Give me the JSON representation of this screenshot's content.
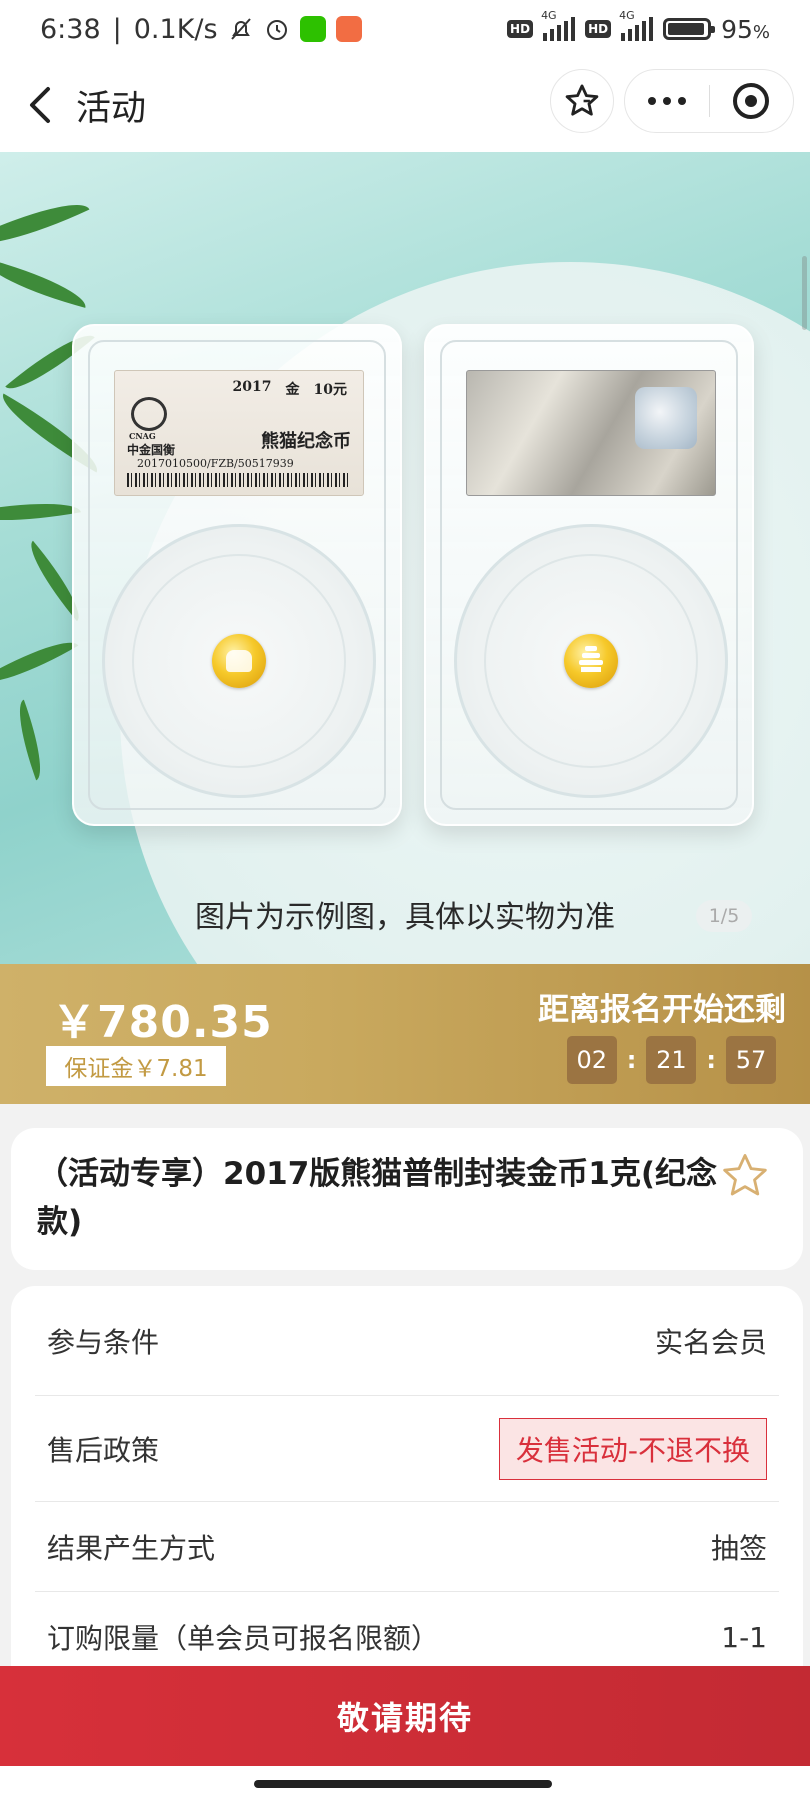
{
  "status_bar": {
    "time": "6:38",
    "speed": "0.1K/s",
    "battery": "95",
    "battery_unit": "%",
    "battery_level": 0.95,
    "network": [
      "HD",
      "4G",
      "HD",
      "4G"
    ]
  },
  "nav": {
    "title": "活动"
  },
  "hero": {
    "caption": "图片为示例图，具体以实物为准",
    "pager": "1/5",
    "label_front": {
      "year": "2017",
      "metal": "金",
      "denomination": "10元",
      "logo_text": "CNAG",
      "grader": "中金国衡",
      "name": "熊猫纪念币",
      "code": "2017010500/FZB/50517939"
    }
  },
  "price_band": {
    "price": "￥780.35",
    "deposit": "保证金￥7.81",
    "countdown_title": "距离报名开始还剩",
    "countdown": {
      "hours": "02",
      "minutes": "21",
      "seconds": "57"
    }
  },
  "product": {
    "title": "（活动专享）2017版熊猫普制封装金币1克(纪念款)"
  },
  "info_rows": [
    {
      "label": "参与条件",
      "value": "实名会员"
    },
    {
      "label": "售后政策",
      "value": "发售活动-不退不换"
    },
    {
      "label": "结果产生方式",
      "value": "抽签"
    },
    {
      "label": "订购限量（单会员可报名限额）",
      "value": "1-1"
    }
  ],
  "cta": {
    "label": "敬请期待"
  },
  "colors": {
    "gold": "#c9a95e",
    "countdown_box": "#9b7442",
    "cta_red": "#d7303a",
    "policy_red": "#d9303c"
  }
}
